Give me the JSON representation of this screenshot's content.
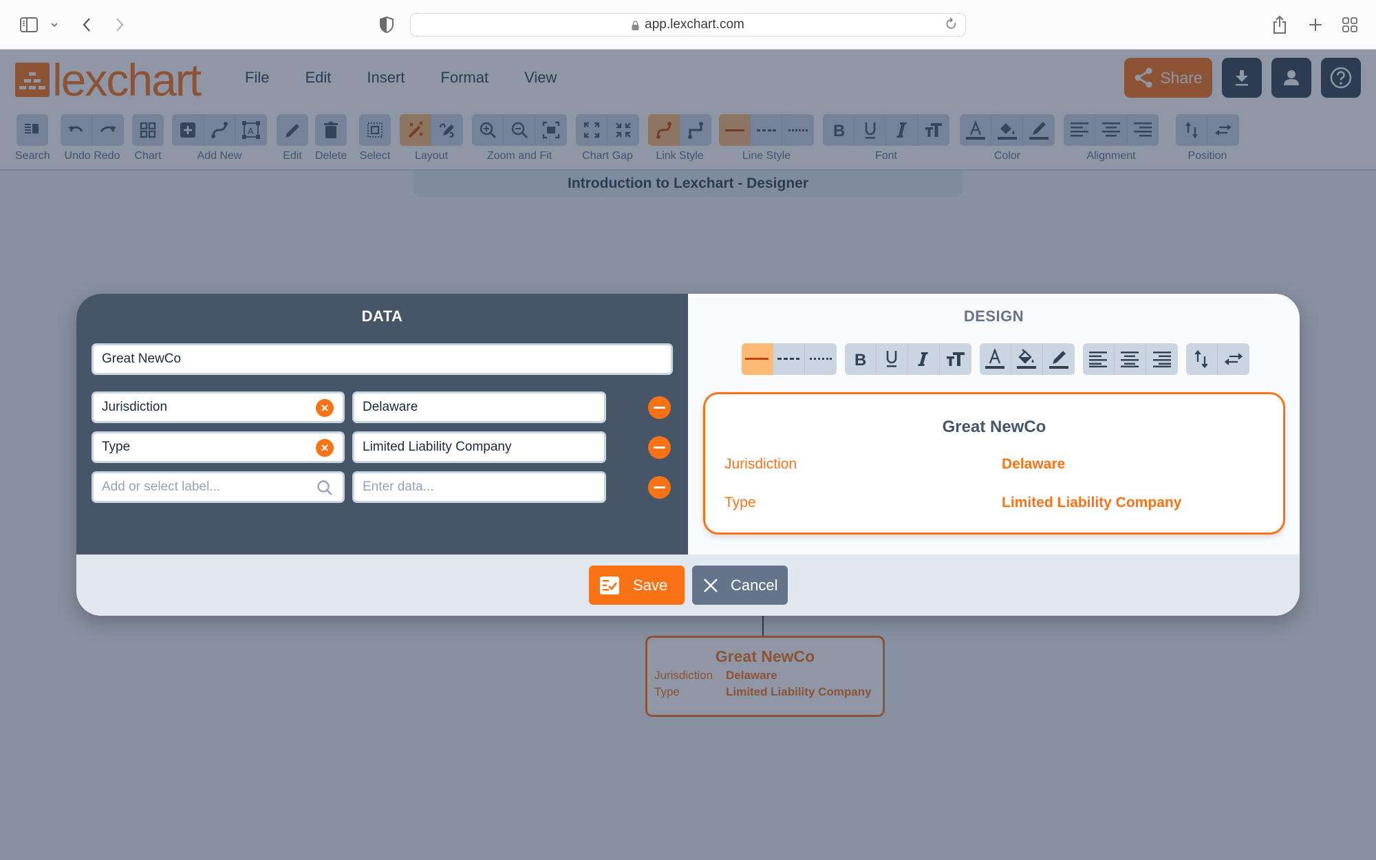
{
  "browser": {
    "url": "app.lexchart.com",
    "icons": [
      "sidebar-icon",
      "chevron-down-icon",
      "back-icon",
      "forward-icon",
      "privacy-shield-icon",
      "lock-icon",
      "reload-icon",
      "share-icon",
      "new-tab-icon",
      "tab-overview-icon"
    ]
  },
  "app": {
    "logo_text": "lexchart",
    "menu": [
      "File",
      "Edit",
      "Insert",
      "Format",
      "View"
    ],
    "share_label": "Share",
    "document_title": "Introduction to Lexchart - Designer",
    "toolbar_groups": [
      {
        "label": "Search",
        "buttons": [
          "search-panel-icon"
        ]
      },
      {
        "label": "Undo Redo",
        "buttons": [
          "undo-icon",
          "redo-icon"
        ]
      },
      {
        "label": "Chart",
        "buttons": [
          "chart-grid-icon"
        ]
      },
      {
        "label": "Add New",
        "buttons": [
          "add-box-icon",
          "add-link-icon",
          "add-text-icon"
        ]
      },
      {
        "label": "Edit",
        "buttons": [
          "pencil-icon"
        ]
      },
      {
        "label": "Delete",
        "buttons": [
          "trash-icon"
        ]
      },
      {
        "label": "Select",
        "buttons": [
          "select-icon"
        ]
      },
      {
        "label": "Layout",
        "buttons": [
          "auto-layout-wand-icon",
          "manual-layout-icon"
        ],
        "active": 0
      },
      {
        "label": "Zoom and Fit",
        "buttons": [
          "zoom-in-icon",
          "zoom-out-icon",
          "fit-icon"
        ]
      },
      {
        "label": "Chart Gap",
        "buttons": [
          "expand-gap-icon",
          "shrink-gap-icon"
        ]
      },
      {
        "label": "Link Style",
        "buttons": [
          "curved-link-icon",
          "elbow-link-icon"
        ],
        "active": 0
      },
      {
        "label": "Line Style",
        "buttons": [
          "solid-line-icon",
          "dashed-line-icon",
          "dotted-line-icon"
        ],
        "active": 0
      },
      {
        "label": "Font",
        "buttons": [
          "bold-icon",
          "underline-icon",
          "italic-icon",
          "font-size-icon"
        ]
      },
      {
        "label": "Color",
        "buttons": [
          "text-color-icon",
          "fill-color-icon",
          "border-color-icon"
        ]
      },
      {
        "label": "Alignment",
        "buttons": [
          "align-left-icon",
          "align-center-icon",
          "align-right-icon"
        ]
      },
      {
        "label": "Position",
        "buttons": [
          "vertical-swap-icon",
          "horizontal-swap-icon"
        ]
      }
    ]
  },
  "canvas_node": {
    "title": "Great NewCo",
    "rows": [
      {
        "label": "Jurisdiction",
        "value": "Delaware"
      },
      {
        "label": "Type",
        "value": "Limited Liability Company"
      }
    ]
  },
  "modal": {
    "data_header": "DATA",
    "design_header": "DESIGN",
    "name_value": "Great NewCo",
    "rows": [
      {
        "label": "Jurisdiction",
        "value": "Delaware"
      },
      {
        "label": "Type",
        "value": "Limited Liability Company"
      }
    ],
    "new_row": {
      "label_placeholder": "Add or select label...",
      "value_placeholder": "Enter data..."
    },
    "preview": {
      "title": "Great NewCo",
      "rows": [
        {
          "label": "Jurisdiction",
          "value": "Delaware"
        },
        {
          "label": "Type",
          "value": "Limited Liability Company"
        }
      ]
    },
    "save_label": "Save",
    "cancel_label": "Cancel"
  },
  "colors": {
    "accent": "#f97316",
    "accent_light": "#fdba74",
    "slate_dark": "#475569",
    "slate": "#64748b"
  }
}
